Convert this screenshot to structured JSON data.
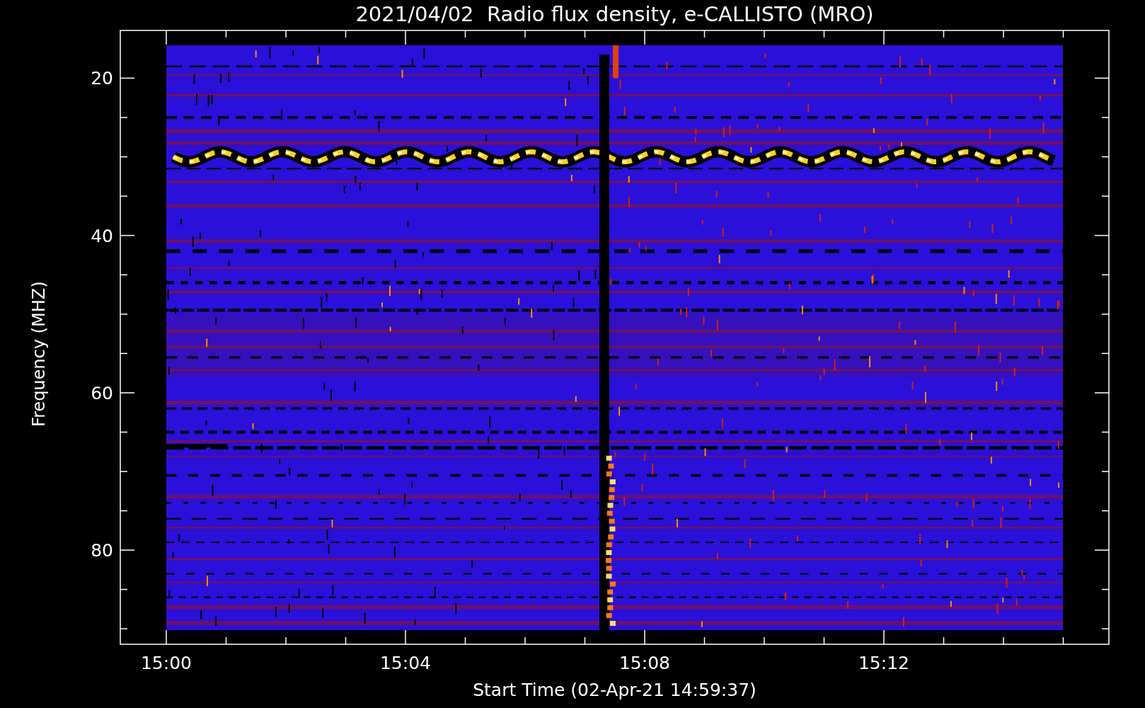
{
  "title": "2021/04/02  Radio flux density, e-CALLISTO (MRO)",
  "plot": {
    "ylabel": "Frequency (MHZ)",
    "xlabel": "Start Time (02-Apr-21 14:59:37)",
    "yticks": [
      "20",
      "40",
      "60",
      "80"
    ],
    "xticks": [
      "15:00",
      "15:04",
      "15:08",
      "15:12"
    ]
  }
}
